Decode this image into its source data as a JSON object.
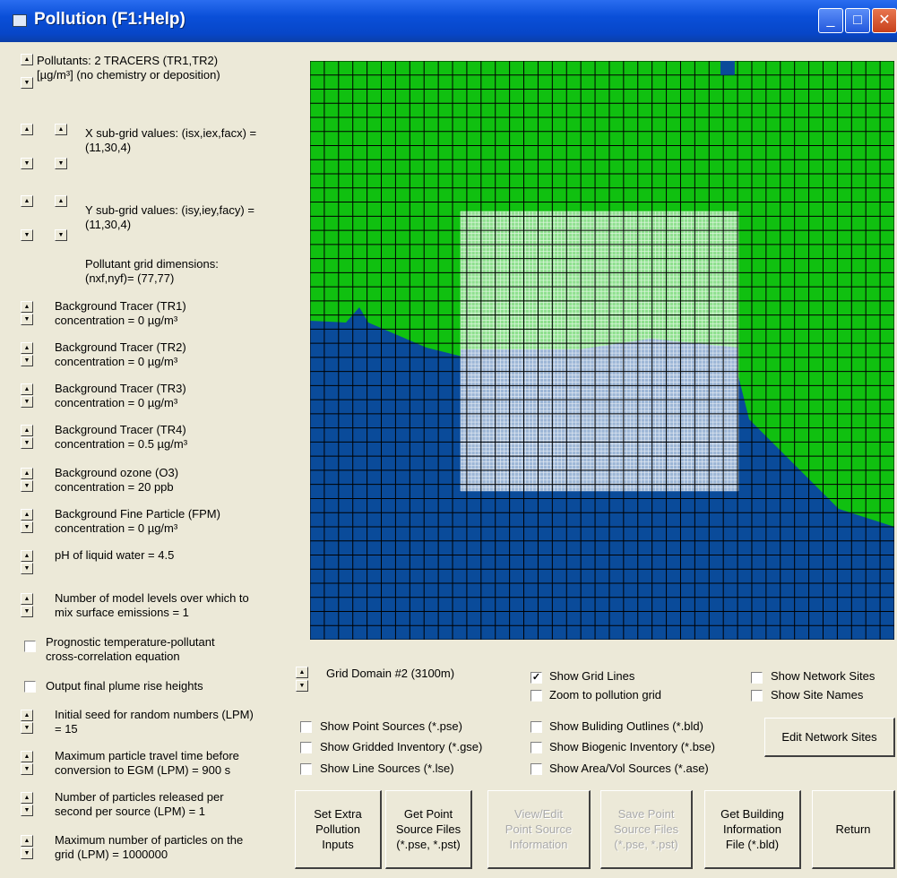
{
  "window": {
    "title": "Pollution (F1:Help)"
  },
  "left": {
    "pollutants": [
      "Pollutants: 2 TRACERS (TR1,TR2)",
      "[µg/m³] (no chemistry or deposition)"
    ],
    "xsub": [
      "X sub-grid values: (isx,iex,facx) =",
      "(11,30,4)"
    ],
    "ysub": [
      "Y sub-grid values: (isy,iey,facy) =",
      "(11,30,4)"
    ],
    "griddim": [
      "Pollutant grid dimensions:",
      "(nxf,nyf)= (77,77)"
    ],
    "params": [
      [
        "Background Tracer (TR1)",
        "concentration = 0 µg/m³"
      ],
      [
        "Background Tracer (TR2)",
        "concentration = 0 µg/m³"
      ],
      [
        "Background Tracer (TR3)",
        "concentration = 0 µg/m³"
      ],
      [
        "Background Tracer (TR4)",
        "concentration = 0.5 µg/m³"
      ],
      [
        "Background ozone (O3)",
        "concentration = 20 ppb"
      ],
      [
        "Background Fine Particle (FPM)",
        "concentration = 0 µg/m³"
      ],
      [
        "pH of liquid water = 4.5",
        ""
      ],
      [
        "Number of model levels over which to",
        "mix surface emissions = 1"
      ]
    ],
    "prognostic": [
      "Prognostic temperature-pollutant",
      "cross-correlation equation"
    ],
    "plume": "Output final plume rise heights",
    "lpm": [
      [
        "Initial seed for random numbers (LPM)",
        "= 15"
      ],
      [
        "Maximum particle travel time before",
        "conversion to EGM (LPM) = 900 s"
      ],
      [
        "Number of particles released per",
        "second per source (LPM) = 1"
      ],
      [
        "Maximum number of particles on the",
        "grid (LPM) = 1000000"
      ]
    ]
  },
  "domain": {
    "label": "Grid Domain #2 (3100m)"
  },
  "options": {
    "show_grid_lines": {
      "label": "Show Grid Lines",
      "checked": true
    },
    "zoom": {
      "label": "Zoom to pollution grid",
      "checked": false
    },
    "network_sites": {
      "label": "Show Network Sites",
      "checked": false
    },
    "site_names": {
      "label": "Show Site Names",
      "checked": false
    },
    "point_sources": {
      "label": "Show Point Sources (*.pse)",
      "checked": false
    },
    "gridded": {
      "label": "Show Gridded Inventory (*.gse)",
      "checked": false
    },
    "line_sources": {
      "label": "Show Line Sources (*.lse)",
      "checked": false
    },
    "building": {
      "label": "Show Buliding Outlines (*.bld)",
      "checked": false
    },
    "biogenic": {
      "label": "Show Biogenic Inventory (*.bse)",
      "checked": false
    },
    "area_vol": {
      "label": "Show Area/Vol Sources (*.ase)",
      "checked": false
    }
  },
  "buttons": {
    "edit_network": "Edit Network Sites",
    "set_extra": "Set Extra\nPollution\nInputs",
    "get_point": "Get Point\nSource Files\n(*.pse, *.pst)",
    "view_edit": "View/Edit\nPoint Source\nInformation",
    "save_point": "Save Point\nSource Files\n(*.pse, *.pst)",
    "get_building": "Get Building\nInformation\nFile (*.bld)",
    "return": "Return"
  },
  "colors": {
    "land": "#10c010",
    "water": "#0a4b9a",
    "subgrid_land": "#8ee08e",
    "subgrid_water": "#9cb6d6"
  }
}
